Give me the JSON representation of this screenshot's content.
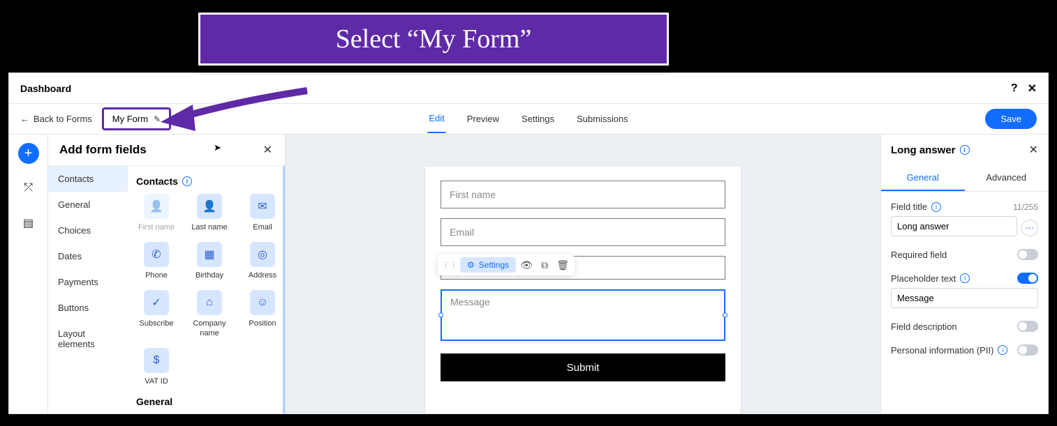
{
  "callout_text": "Select “My Form”",
  "dashboard_title": "Dashboard",
  "back_label": "Back to Forms",
  "form_name": "My Form",
  "tabs": {
    "edit": "Edit",
    "preview": "Preview",
    "settings": "Settings",
    "submissions": "Submissions"
  },
  "save_label": "Save",
  "fields_panel": {
    "title": "Add form fields",
    "categories": [
      "Contacts",
      "General",
      "Choices",
      "Dates",
      "Payments",
      "Buttons",
      "Layout elements"
    ],
    "group1_title": "Contacts",
    "tiles": [
      {
        "label": "First name",
        "glyph": "☺",
        "disabled": true
      },
      {
        "label": "Last name",
        "glyph": "☺"
      },
      {
        "label": "Email",
        "glyph": "✉"
      },
      {
        "label": "Phone",
        "glyph": "☎"
      },
      {
        "label": "Birthday",
        "glyph": "Ὄ5"
      },
      {
        "label": "Address",
        "glyph": "◎"
      },
      {
        "label": "Subscribe",
        "glyph": "✓"
      },
      {
        "label": "Company name",
        "glyph": "▢"
      },
      {
        "label": "Position",
        "glyph": "☺"
      },
      {
        "label": "VAT ID",
        "glyph": "$"
      }
    ],
    "group2_title": "General"
  },
  "canvas": {
    "firstname_ph": "First name",
    "email_ph": "Email",
    "settings_label": "Settings",
    "message_ph": "Message",
    "submit_label": "Submit"
  },
  "props": {
    "title": "Long answer",
    "tab_general": "General",
    "tab_advanced": "Advanced",
    "field_title_label": "Field title",
    "field_title_value": "Long answer",
    "counter": "11/255",
    "required_label": "Required field",
    "placeholder_label": "Placeholder text",
    "placeholder_value": "Message",
    "description_label": "Field description",
    "pii_label": "Personal information (PII)"
  }
}
